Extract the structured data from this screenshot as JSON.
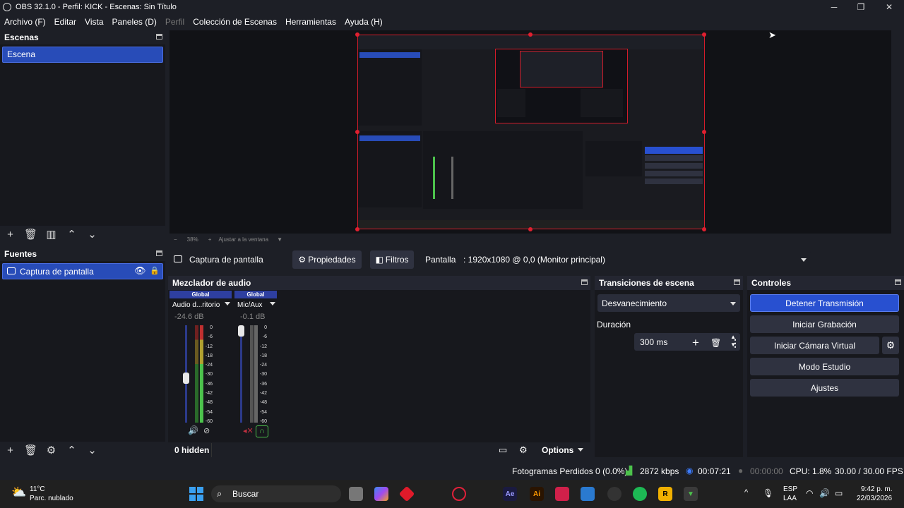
{
  "window": {
    "title": "OBS 32.1.0 - Perfil: KICK - Escenas: Sin Título",
    "minimize_glyph": "─",
    "maximize_glyph": "❐",
    "close_glyph": "✕"
  },
  "menu": [
    "Archivo (F)",
    "Editar",
    "Vista",
    "Paneles (D)",
    "Perfil",
    "Colección de Escenas",
    "Herramientas",
    "Ayuda (H)"
  ],
  "scenes": {
    "title": "Escenas",
    "items": [
      "Escena"
    ]
  },
  "sources": {
    "title": "Fuentes",
    "items": [
      "Captura de pantalla"
    ]
  },
  "preview": {
    "zoom_minus": "−",
    "zoom": "38%",
    "zoom_plus": "+",
    "fit": "Ajustar a la ventana"
  },
  "source_bar": {
    "name": "Captura de pantalla",
    "properties": "Propiedades",
    "filters": "Filtros",
    "display_label": "Pantalla",
    "display_value": ": 1920x1080 @ 0,0 (Monitor principal)"
  },
  "mixer": {
    "title": "Mezclador de audio",
    "scale": [
      "0",
      "-6",
      "-12",
      "-18",
      "-24",
      "-30",
      "-36",
      "-42",
      "-48",
      "-54",
      "-60"
    ],
    "channels": [
      {
        "tag": "Global",
        "name": "Audio d...ritorio",
        "db": "-24.6 dB",
        "level": 0.55
      },
      {
        "tag": "Global",
        "name": "Mic/Aux",
        "db": "-0.1 dB",
        "level": 0.0
      }
    ],
    "hidden": "0 hidden",
    "options": "Options"
  },
  "transitions": {
    "title": "Transiciones de escena",
    "type": "Desvanecimiento",
    "duration_label": "Duración",
    "duration_value": "300 ms"
  },
  "controls": {
    "title": "Controles",
    "buttons": [
      "Detener Transmisión",
      "Iniciar Grabación",
      "Iniciar Cámara Virtual",
      "Modo Estudio",
      "Ajustes"
    ]
  },
  "status": {
    "dropped": "Fotogramas Perdidos 0 (0.0%)",
    "kbps": "2872 kbps",
    "stream_time": "00:07:21",
    "rec_time": "00:00:00",
    "cpu": "CPU: 1.8%",
    "fps": "30.00 / 30.00 FPS"
  },
  "taskbar": {
    "weather_temp": "11°C",
    "weather_desc": "Parc. nublado",
    "search": "Buscar",
    "lang1": "ESP",
    "lang2": "LAA",
    "time": "9:42 p. m.",
    "date": "22/03/2026",
    "ae": "Ae",
    "ai": "Ai",
    "r": "R",
    "up_arrow": "^"
  },
  "colors": {
    "accent": "#284cb8",
    "stream_button": "#2850d0",
    "meter_green": "#4cc24c",
    "meter_yellow": "#b0a030",
    "meter_red": "#c03030"
  }
}
